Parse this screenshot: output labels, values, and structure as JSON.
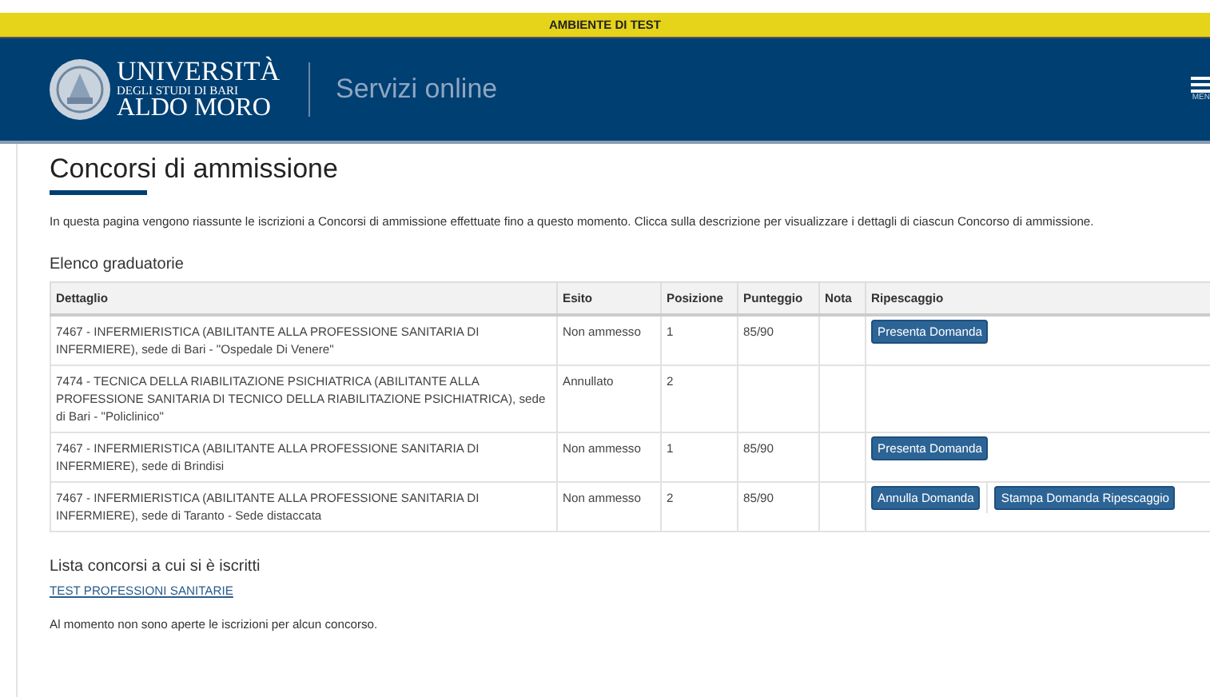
{
  "env_banner": "AMBIENTE DI TEST",
  "header": {
    "logo_line1": "UNIVERSITÀ",
    "logo_line2": "DEGLI STUDI DI BARI",
    "logo_line3": "ALDO MORO",
    "service": "Servizi online",
    "menu_label": "MEN"
  },
  "title": "Concorsi di ammissione",
  "intro": "In questa pagina vengono riassunte le iscrizioni a Concorsi di ammissione effettuate fino a questo momento. Clicca sulla descrizione per visualizzare i dettagli di ciascun Concorso di ammissione.",
  "table": {
    "title": "Elenco graduatorie",
    "columns": [
      "Dettaglio",
      "Esito",
      "Posizione",
      "Punteggio",
      "Nota",
      "Ripescaggio"
    ],
    "rows": [
      {
        "dettaglio": "7467 - INFERMIERISTICA (ABILITANTE ALLA PROFESSIONE SANITARIA DI INFERMIERE), sede di Bari - \"Ospedale Di Venere\"",
        "esito": "Non ammesso",
        "posizione": "1",
        "punteggio": "85/90",
        "buttons": [
          "Presenta Domanda"
        ]
      },
      {
        "dettaglio": "7474 - TECNICA DELLA RIABILITAZIONE PSICHIATRICA (ABILITANTE ALLA PROFESSIONE SANITARIA DI TECNICO DELLA RIABILITAZIONE PSICHIATRICA), sede di Bari - \"Policlinico\"",
        "esito": "Annullato",
        "posizione": "2",
        "punteggio": "",
        "buttons": []
      },
      {
        "dettaglio": "7467 - INFERMIERISTICA (ABILITANTE ALLA PROFESSIONE SANITARIA DI INFERMIERE), sede di Brindisi",
        "esito": "Non ammesso",
        "posizione": "1",
        "punteggio": "85/90",
        "buttons": [
          "Presenta Domanda"
        ]
      },
      {
        "dettaglio": "7467 - INFERMIERISTICA (ABILITANTE ALLA PROFESSIONE SANITARIA DI INFERMIERE), sede di Taranto - Sede distaccata",
        "esito": "Non ammesso",
        "posizione": "2",
        "punteggio": "85/90",
        "buttons": [
          "Annulla Domanda",
          "Stampa Domanda Ripescaggio"
        ]
      }
    ]
  },
  "list_title": "Lista concorsi a cui si è iscritti",
  "list_link": "TEST PROFESSIONI SANITARIE",
  "footer_note": "Al momento non sono aperte le iscrizioni per alcun concorso."
}
